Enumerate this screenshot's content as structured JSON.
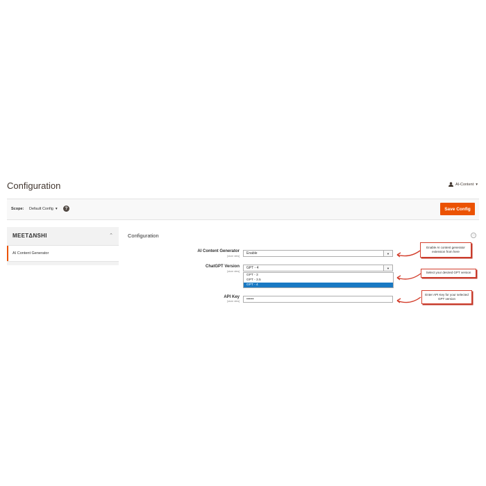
{
  "header": {
    "page_title": "Configuration",
    "user_name": "AI-Content",
    "user_caret": "▾"
  },
  "scope_bar": {
    "label": "Scope:",
    "value": "Default Config",
    "caret": "▾",
    "help": "?",
    "save_label": "Save Config"
  },
  "sidebar": {
    "brand": "MEETΔNSHI",
    "chevron": "⌃",
    "items": [
      {
        "label": "AI Content Generator",
        "active": true
      }
    ]
  },
  "main": {
    "section_title": "Configuration",
    "collapse_symbol": "⊖",
    "fields": [
      {
        "label": "AI Content Generator",
        "scope": "[store view]",
        "type": "select",
        "value": "Enable"
      },
      {
        "label": "ChatGPT Version",
        "scope": "[store view]",
        "type": "select",
        "value": "GPT - 4",
        "options": [
          "GPT - 3",
          "GPT - 3.5",
          "GPT - 4"
        ],
        "selected_index": 2
      },
      {
        "label": "API Key",
        "scope": "[store view]",
        "type": "password",
        "value": "••••••"
      }
    ]
  },
  "annotations": [
    {
      "text": "Enable AI content generator extension from here"
    },
    {
      "text": "Select your desired GPT version"
    },
    {
      "text": "Enter API Key for your selected GPT version"
    }
  ],
  "colors": {
    "accent": "#eb5202",
    "annotation_border": "#d33d2b",
    "selected_option": "#1979c3"
  }
}
